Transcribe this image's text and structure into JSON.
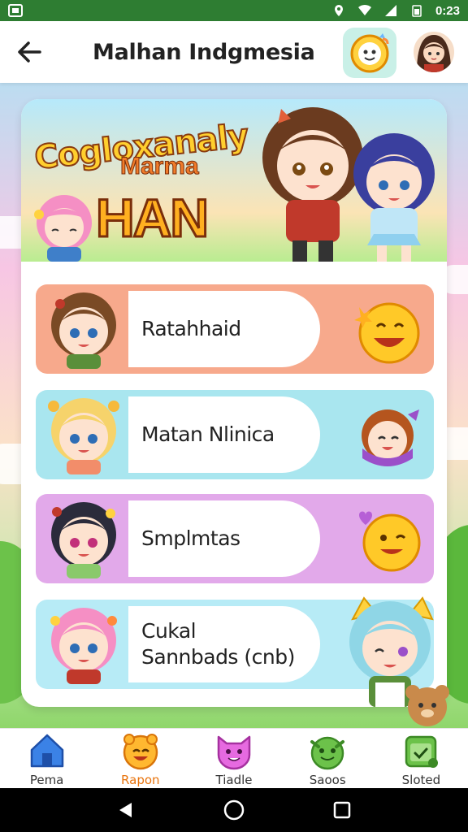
{
  "status_bar": {
    "time": "0:23"
  },
  "header": {
    "title": "Malhan Indgmesia"
  },
  "banner": {
    "title_line1": "Cogloxanaly",
    "title_line2": "Marma",
    "title_line3": "HAN"
  },
  "menu": [
    {
      "label": "Ratahhaid",
      "color": "#f7a98c"
    },
    {
      "label": "Matan Nlinica",
      "color": "#a9e6ef"
    },
    {
      "label": "Smplmtas",
      "color": "#e2a9ea"
    },
    {
      "label_line1": "Cukal",
      "label_line2": "Sannbads (cnb)",
      "color": "#b7ebf6"
    }
  ],
  "bottom_nav": [
    {
      "label": "Pema",
      "icon": "home-icon",
      "active": false
    },
    {
      "label": "Rapon",
      "icon": "smiley-icon",
      "active": true
    },
    {
      "label": "Tiadle",
      "icon": "cat-face-icon",
      "active": false
    },
    {
      "label": "Saoos",
      "icon": "frog-face-icon",
      "active": false
    },
    {
      "label": "Sloted",
      "icon": "calendar-icon",
      "active": false
    }
  ],
  "colors": {
    "status_bar": "#2e7d32",
    "accent_active": "#e8730c",
    "card_bg": "#ffffff"
  }
}
